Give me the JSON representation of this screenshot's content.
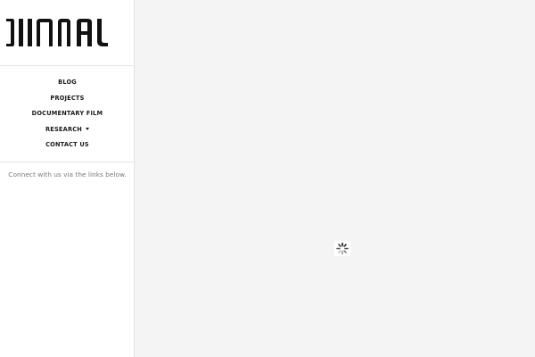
{
  "logo": {
    "alt": "DIMAL logo",
    "icon": "dimal-logotype"
  },
  "nav": {
    "items": [
      {
        "label": "BLOG"
      },
      {
        "label": "PROJECTS"
      },
      {
        "label": "DOCUMENTARY FILM"
      },
      {
        "label": "RESEARCH",
        "has_dropdown": true
      },
      {
        "label": "CONTACT US"
      }
    ]
  },
  "connect_text": "Connect with us via the links below.",
  "main": {
    "loading_icon": "spinner-icon"
  },
  "colors": {
    "sidebar_bg": "#ffffff",
    "main_bg": "#f4f4f4",
    "nav_text": "#1a1a1a",
    "muted_text": "#7a7a7a"
  }
}
